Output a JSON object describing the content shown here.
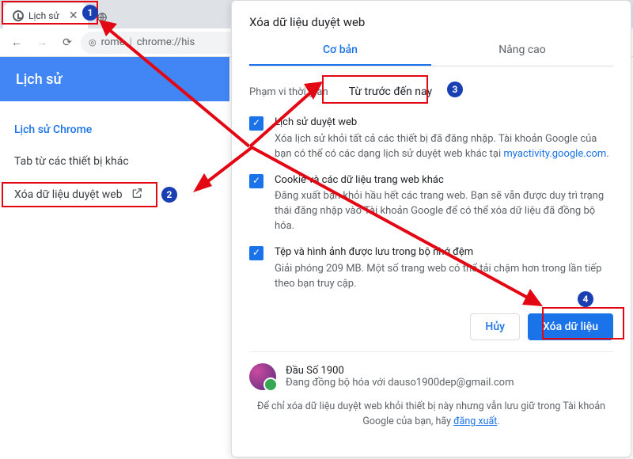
{
  "browser": {
    "tab_title": "Lịch sử",
    "url_host": "rome",
    "url_path": "chrome://his"
  },
  "history_page": {
    "title": "Lịch sử",
    "nav_chrome_history": "Lịch sử Chrome",
    "nav_other_devices": "Tab từ các thiết bị khác",
    "nav_clear_data": "Xóa dữ liệu duyệt web"
  },
  "dialog": {
    "title": "Xóa dữ liệu duyệt web",
    "tab_basic": "Cơ bản",
    "tab_advanced": "Nâng cao",
    "time_range_label": "Phạm vi thời gian",
    "time_range_value": "Từ trước đến nay",
    "options": [
      {
        "title": "Lịch sử duyệt web",
        "desc_a": "Xóa lịch sử khỏi tất cả các thiết bị đã đăng nhập. Tài khoản Google của bạn có thể có các dạng lịch sử duyệt web khác tại ",
        "link": "myactivity.google.com",
        "desc_b": "."
      },
      {
        "title": "Cookie và các dữ liệu trang web khác",
        "desc_a": "Đăng xuất bạn khỏi hầu hết các trang web. Bạn sẽ vẫn được duy trì trạng thái đăng nhập vào Tài khoản Google để có thể xóa dữ liệu đã đồng bộ hóa.",
        "link": "",
        "desc_b": ""
      },
      {
        "title": "Tệp và hình ảnh được lưu trong bộ nhớ đệm",
        "desc_a": "Giải phóng 209 MB. Một số trang web có thể tải chậm hơn trong lần tiếp theo bạn truy cập.",
        "link": "",
        "desc_b": ""
      }
    ],
    "btn_cancel": "Hủy",
    "btn_clear": "Xóa dữ liệu",
    "account_name": "Đầu Số 1900",
    "account_status": "Đang đồng bộ hóa với dauso1900dep@gmail.com",
    "footer_a": "Để chỉ xóa dữ liệu duyệt web khỏi thiết bị này nhưng vẫn lưu giữ trong Tài khoản Google của bạn, hãy ",
    "footer_link": "đăng xuất",
    "footer_b": "."
  },
  "annotations": {
    "1": "1",
    "2": "2",
    "3": "3",
    "4": "4"
  }
}
